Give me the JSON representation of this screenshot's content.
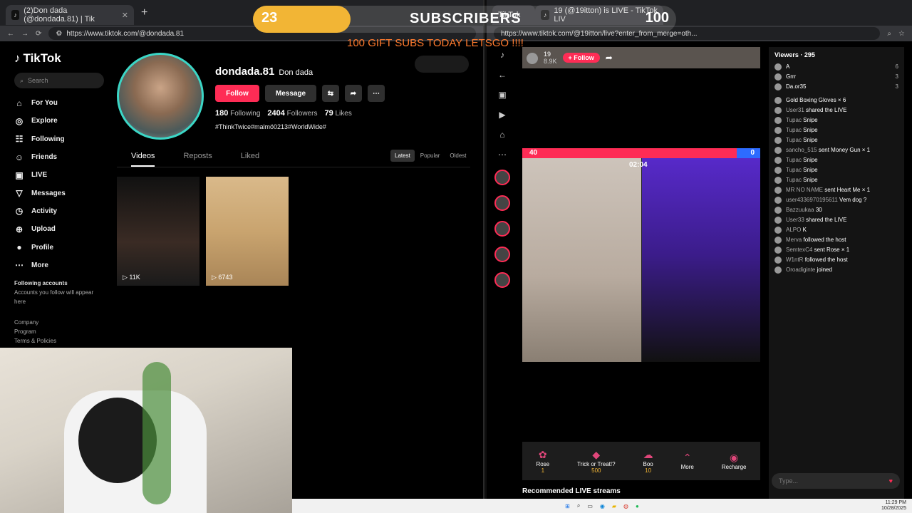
{
  "left_window": {
    "tab_title": "(2)Don dada (@dondada.81) | Tik",
    "url": "https://www.tiktok.com/@dondada.81"
  },
  "right_window": {
    "tab1": "TikTok",
    "tab2": "19 (@19itton) is LIVE - TikTok LIV",
    "url": "https://www.tiktok.com/@19itton/live?enter_from_merge=oth..."
  },
  "overlay": {
    "current": "23",
    "title": "SUBSCRIBERS",
    "goal": "100",
    "progress": 0.23,
    "subtitle": "100 GIFT SUBS TODAY LETSGO !!!!"
  },
  "sidebar": {
    "logo": "TikTok",
    "search_placeholder": "Search",
    "items": [
      {
        "label": "For You",
        "icon": "home-icon"
      },
      {
        "label": "Explore",
        "icon": "compass-icon"
      },
      {
        "label": "Following",
        "icon": "following-icon"
      },
      {
        "label": "Friends",
        "icon": "friends-icon"
      },
      {
        "label": "LIVE",
        "icon": "live-icon"
      },
      {
        "label": "Messages",
        "icon": "messages-icon"
      },
      {
        "label": "Activity",
        "icon": "activity-icon"
      },
      {
        "label": "Upload",
        "icon": "upload-icon"
      },
      {
        "label": "Profile",
        "icon": "profile-icon"
      },
      {
        "label": "More",
        "icon": "more-icon"
      }
    ],
    "following_title": "Following accounts",
    "following_note": "Accounts you follow will appear here",
    "footer": [
      "Company",
      "Program",
      "Terms & Policies"
    ]
  },
  "profile": {
    "username": "dondada.81",
    "display_name": "Don dada",
    "follow": "Follow",
    "message": "Message",
    "following_count": "180",
    "following_label": "Following",
    "followers_count": "2404",
    "followers_label": "Followers",
    "likes_count": "79",
    "likes_label": "Likes",
    "bio": "#ThinkTwice#malmö0213#WorldWide#"
  },
  "content_tabs": [
    "Videos",
    "Reposts",
    "Liked"
  ],
  "sort": [
    "Latest",
    "Popular",
    "Oldest"
  ],
  "videos": [
    {
      "views": "11K"
    },
    {
      "views": "6743"
    }
  ],
  "live": {
    "host": "19",
    "host_likes": "8.9K",
    "follow": "+ Follow",
    "score_left": "40",
    "score_right": "0",
    "timer": "02:04",
    "gifts": [
      {
        "name": "Rose",
        "price": "1"
      },
      {
        "name": "Trick or Treat!?",
        "price": "500"
      },
      {
        "name": "Boo",
        "price": "10"
      },
      {
        "name": "More",
        "price": ""
      },
      {
        "name": "Recharge",
        "price": ""
      }
    ],
    "recommended": "Recommended LIVE streams"
  },
  "chat": {
    "viewers_label": "Viewers · 295",
    "top_viewers": [
      {
        "name": "A",
        "count": "6"
      },
      {
        "name": "Grrr",
        "count": "3"
      },
      {
        "name": "Da.or35",
        "count": "3"
      }
    ],
    "messages": [
      {
        "name": "",
        "text": "Gold Boxing Gloves × 6"
      },
      {
        "name": "User31",
        "text": "shared the LIVE"
      },
      {
        "name": "Tupac",
        "text": "Snipe"
      },
      {
        "name": "Tupac",
        "text": "Snipe"
      },
      {
        "name": "Tupac",
        "text": "Snipe"
      },
      {
        "name": "sancho_515",
        "text": "sent Money Gun × 1"
      },
      {
        "name": "Tupac",
        "text": "Snipe"
      },
      {
        "name": "Tupac",
        "text": "Snipe"
      },
      {
        "name": "Tupac",
        "text": "Snipe"
      },
      {
        "name": "MR NO NAME",
        "text": "sent Heart Me × 1"
      },
      {
        "name": "user4336970195611",
        "text": "Vem dog ?"
      },
      {
        "name": "Bazzuukaa",
        "text": "30"
      },
      {
        "name": "User33",
        "text": "shared the LIVE"
      },
      {
        "name": "ALPO",
        "text": "K"
      },
      {
        "name": "Merva",
        "text": "followed the host"
      },
      {
        "name": "SemtexC4",
        "text": "sent Rose × 1"
      },
      {
        "name": "W1ntR",
        "text": "followed the host"
      },
      {
        "name": "Oroadiginte",
        "text": "joined"
      }
    ],
    "type_placeholder": "Type..."
  },
  "taskbar": {
    "time": "11:29 PM",
    "date": "10/28/2025"
  },
  "colors": {
    "accent": "#fe2c55",
    "avatar_ring": "#3bd6c6",
    "bar_fill": "#f2b535",
    "goal_text": "#ff7b2e"
  }
}
